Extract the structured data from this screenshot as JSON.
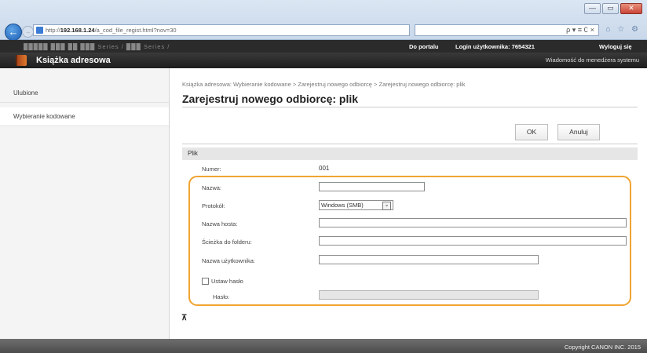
{
  "browser": {
    "url_prefix": "http://",
    "url_host": "192.168.1.24",
    "url_path": "/a_cod_file_regist.html?nov=30",
    "search_tools": "ρ ▾ ≡ ∁ ×",
    "window_controls": [
      "—",
      "▭",
      "✕"
    ],
    "right_icons": "⌂ ☆ ⚙"
  },
  "topbar": {
    "model": "█████ ███ ██ ███ Series / ███ Series /",
    "portal": "Do portalu",
    "login": "Login użytkownika:  7654321",
    "logout": "Wyloguj się"
  },
  "titlebar": {
    "title": "Książka adresowa",
    "message": "Wiadomość do menedżera systemu"
  },
  "sidebar": {
    "items": [
      {
        "label": "Ulubione"
      },
      {
        "label": "Wybieranie kodowane"
      }
    ]
  },
  "main": {
    "breadcrumb": "Książka adresowa: Wybieranie kodowane > Zarejestruj nowego odbiorcę > Zarejestruj nowego odbiorcę: plik",
    "title": "Zarejestruj nowego odbiorcę: plik",
    "ok_label": "OK",
    "cancel_label": "Anuluj",
    "section": "Plik",
    "number_label": "Numer:",
    "number_value": "001",
    "name_label": "Nazwa:",
    "name_value": "",
    "protocol_label": "Protokół:",
    "protocol_value": "Windows (SMB)",
    "host_label": "Nazwa hosta:",
    "host_value": "",
    "path_label": "Ścieżka do folderu:",
    "path_value": "",
    "user_label": "Nazwa użytkownika:",
    "user_value": "",
    "set_password_label": "Ustaw hasło",
    "password_label": "Hasło:",
    "password_value": ""
  },
  "footer": {
    "copyright": "Copyright CANON INC. 2015"
  },
  "colors": {
    "highlight": "#f0a431",
    "topbar": "#2b2b2b"
  }
}
